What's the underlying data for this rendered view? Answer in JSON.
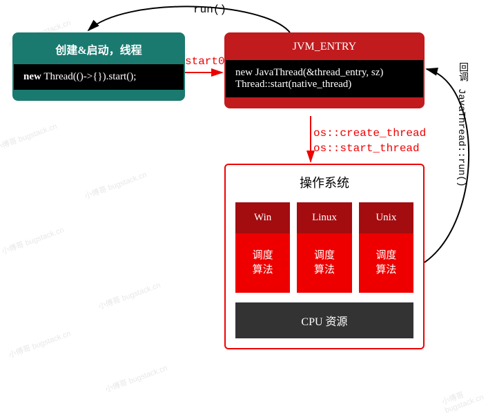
{
  "left_box": {
    "title": "创建&启动，线程",
    "code_prefix": "new",
    "code_rest": " Thread(()->{}).start();"
  },
  "right_box": {
    "title": "JVM_ENTRY",
    "code_line1": "new JavaThread(&thread_entry, sz)",
    "code_line2": "Thread::start(native_thread)"
  },
  "os_box": {
    "title": "操作系统",
    "cols": [
      {
        "name": "Win",
        "body": "调度\n算法"
      },
      {
        "name": "Linux",
        "body": "调度\n算法"
      },
      {
        "name": "Unix",
        "body": "调度\n算法"
      }
    ],
    "cpu": "CPU 资源"
  },
  "labels": {
    "run": "run()",
    "start0": "start0",
    "os_create": "os::create_thread",
    "os_start": "os::start_thread",
    "callback1": "回调",
    "callback2": "JavaThread::run()"
  },
  "watermark": "小傅哥 bugstack.cn"
}
